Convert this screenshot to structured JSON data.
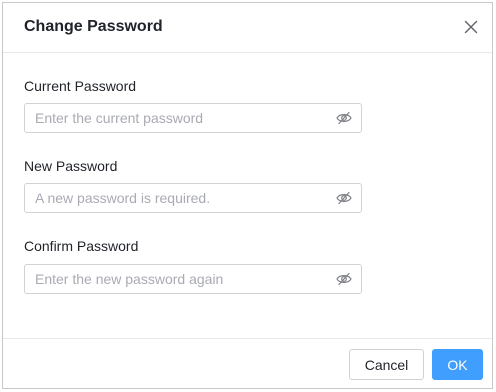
{
  "dialog": {
    "title": "Change Password",
    "close_icon": "close-icon"
  },
  "fields": [
    {
      "label": "Current Password",
      "placeholder": "Enter the current password",
      "value": "",
      "icon": "eye-hidden-icon"
    },
    {
      "label": "New Password",
      "placeholder": "A new password is required.",
      "value": "",
      "icon": "eye-hidden-icon"
    },
    {
      "label": "Confirm Password",
      "placeholder": "Enter the new password again",
      "value": "",
      "icon": "eye-hidden-icon"
    }
  ],
  "footer": {
    "cancel_label": "Cancel",
    "ok_label": "OK"
  },
  "colors": {
    "primary": "#409eff",
    "border": "#d0d3d6",
    "text": "#1f2329",
    "placeholder": "#a8abb2"
  }
}
